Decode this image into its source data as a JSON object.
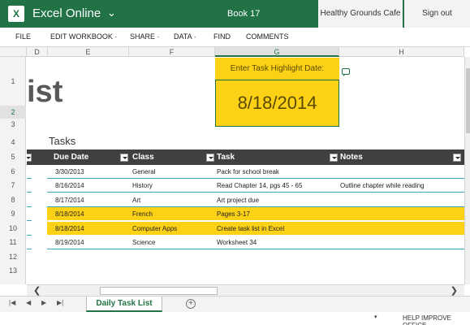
{
  "app": {
    "logo_letter": "X",
    "name": "Excel Online",
    "book": "Book 17",
    "account": "Healthy Grounds Cafe",
    "signout": "Sign out"
  },
  "ribbon": [
    "FILE",
    "EDIT WORKBOOK ·",
    "SHARE ·",
    "DATA ·",
    "FIND",
    "COMMENTS"
  ],
  "columns": [
    "D",
    "E",
    "F",
    "G",
    "H"
  ],
  "rows": [
    "1",
    "2",
    "3",
    "4",
    "5",
    "6",
    "7",
    "8",
    "9",
    "10",
    "11",
    "12",
    "13"
  ],
  "sheet": {
    "title_fragment": "ist",
    "highlight_label": "Enter Task Highlight Date:",
    "highlight_date": "8/18/2014",
    "tasks_heading": "Tasks",
    "table_headers": [
      "Due Date",
      "Class",
      "Task",
      "Notes"
    ],
    "table_rows": [
      {
        "due": "3/30/2013",
        "class": "General",
        "task": "Pack for school break",
        "notes": "",
        "highlight": false
      },
      {
        "due": "8/16/2014",
        "class": "History",
        "task": "Read Chapter 14, pgs 45 - 65",
        "notes": "Outline chapter while reading",
        "highlight": false
      },
      {
        "due": "8/17/2014",
        "class": "Art",
        "task": "Art project due",
        "notes": "",
        "highlight": false
      },
      {
        "due": "8/18/2014",
        "class": "French",
        "task": "Pages 3-17",
        "notes": "",
        "highlight": true
      },
      {
        "due": "8/18/2014",
        "class": "Computer Apps",
        "task": "Create task list in Excel",
        "notes": "",
        "highlight": true
      },
      {
        "due": "8/19/2014",
        "class": "Science",
        "task": "Worksheet 34",
        "notes": "",
        "highlight": false
      }
    ]
  },
  "sheet_tab": "Daily Task List",
  "add_sheet": "+",
  "status": {
    "arrow": "▾",
    "text": "HELP IMPROVE OFFICE"
  },
  "colors": {
    "excel_green": "#217346",
    "highlight_yellow": "#fcd116",
    "header_dark": "#404040",
    "row_line": "#3aa6b9"
  }
}
